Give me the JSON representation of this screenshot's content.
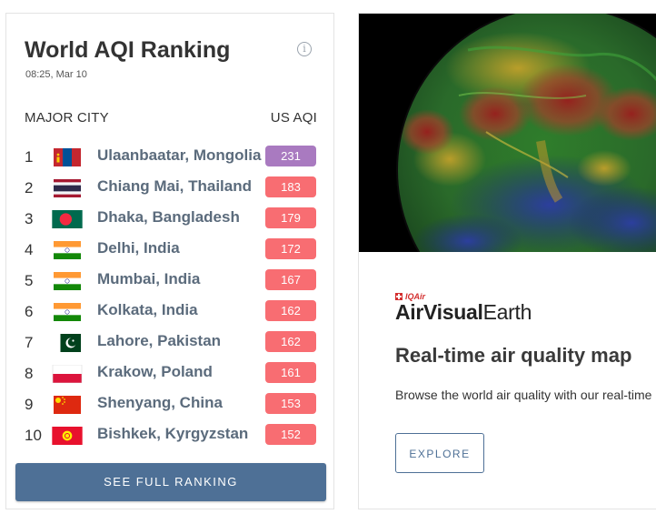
{
  "ranking": {
    "title": "World AQI Ranking",
    "timestamp": "08:25, Mar 10",
    "col_city": "MAJOR CITY",
    "col_aqi": "US AQI",
    "see_full_label": "SEE FULL RANKING",
    "rows": [
      {
        "rank": "1",
        "city": "Ulaanbaatar, Mongolia",
        "aqi": "231",
        "color": "#a97ac0",
        "flag": "mongolia"
      },
      {
        "rank": "2",
        "city": "Chiang Mai, Thailand",
        "aqi": "183",
        "color": "#f86d72",
        "flag": "thailand"
      },
      {
        "rank": "3",
        "city": "Dhaka, Bangladesh",
        "aqi": "179",
        "color": "#f86d72",
        "flag": "bangladesh"
      },
      {
        "rank": "4",
        "city": "Delhi, India",
        "aqi": "172",
        "color": "#f86d72",
        "flag": "india"
      },
      {
        "rank": "5",
        "city": "Mumbai, India",
        "aqi": "167",
        "color": "#f86d72",
        "flag": "india"
      },
      {
        "rank": "6",
        "city": "Kolkata, India",
        "aqi": "162",
        "color": "#f86d72",
        "flag": "india"
      },
      {
        "rank": "7",
        "city": "Lahore, Pakistan",
        "aqi": "162",
        "color": "#f86d72",
        "flag": "pakistan"
      },
      {
        "rank": "8",
        "city": "Krakow, Poland",
        "aqi": "161",
        "color": "#f86d72",
        "flag": "poland"
      },
      {
        "rank": "9",
        "city": "Shenyang, China",
        "aqi": "153",
        "color": "#f86d72",
        "flag": "china"
      },
      {
        "rank": "10",
        "city": "Bishkek, Kyrgyzstan",
        "aqi": "152",
        "color": "#f86d72",
        "flag": "kyrgyzstan"
      }
    ]
  },
  "earth": {
    "brand_small": "IQAir",
    "brand_air": "AirVisual",
    "brand_earth": "Earth",
    "heading": "Real-time air quality map",
    "description": "Browse the world air quality with our real-time air pollution map",
    "explore_label": "EXPLORE"
  },
  "colors": {
    "button_blue": "#4e7096",
    "purple_aqi": "#a97ac0",
    "red_aqi": "#f86d72"
  }
}
